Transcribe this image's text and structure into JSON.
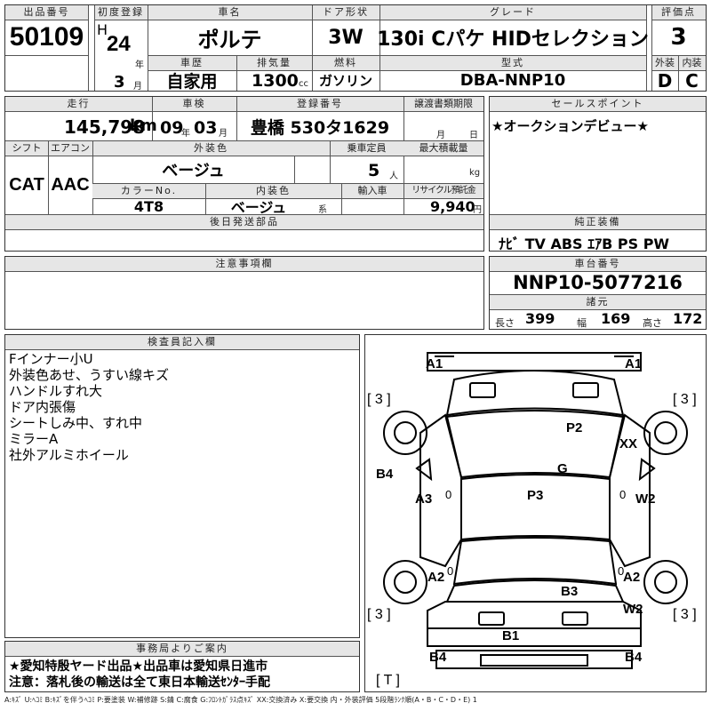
{
  "lot": {
    "label": "出品番号",
    "value": "50109"
  },
  "first_reg": {
    "label": "初度登録",
    "era": "H",
    "year": "24",
    "year_unit": "年",
    "month": "3",
    "month_unit": "月"
  },
  "car_name": {
    "label": "車名",
    "value": "ポルテ"
  },
  "door": {
    "label": "ドア形状",
    "value": "3W"
  },
  "grade": {
    "label": "グレード",
    "value": "130i Cパケ HIDセレクション"
  },
  "score": {
    "label": "評価点",
    "value": "3"
  },
  "history": {
    "label": "車歴",
    "value": "自家用"
  },
  "displacement": {
    "label": "排気量",
    "value": "1300",
    "unit": "cc"
  },
  "fuel": {
    "label": "燃料",
    "value": "ガソリン"
  },
  "model_code": {
    "label": "型式",
    "value": "DBA-NNP10"
  },
  "ext_grade": {
    "label": "外装",
    "value": "D"
  },
  "int_grade": {
    "label": "内装",
    "value": "C"
  },
  "mileage": {
    "label": "走行",
    "value": "145,798",
    "unit": "km"
  },
  "inspection": {
    "label": "車検",
    "year": "09",
    "year_unit": "年",
    "month": "03",
    "month_unit": "月"
  },
  "registration": {
    "label": "登録番号",
    "value": "豊橋 530タ1629"
  },
  "transfer": {
    "label": "譲渡書類期限",
    "month_unit": "月",
    "day_unit": "日"
  },
  "shift": {
    "label": "シフト",
    "value": "CAT"
  },
  "aircon": {
    "label": "エアコン",
    "value": "AAC"
  },
  "ext_color": {
    "label": "外装色",
    "value": "ベージュ"
  },
  "capacity": {
    "label": "乗車定員",
    "value": "5",
    "unit": "人"
  },
  "max_load": {
    "label": "最大積載量",
    "unit": "kg"
  },
  "color_no": {
    "label": "カラーNo.",
    "value": "4T8"
  },
  "int_color": {
    "label": "内装色",
    "value": "ベージュ",
    "unit": "系"
  },
  "import": {
    "label": "輸入車"
  },
  "recycle": {
    "label": "リサイクル預託金",
    "value": "9,940",
    "unit": "円"
  },
  "later_parts": {
    "label": "後日発送部品"
  },
  "sales_point": {
    "label": "セールスポイント",
    "value": "★オークションデビュー★"
  },
  "equipment": {
    "label": "純正装備",
    "value": "ﾅﾋﾞ TV ABS ｴｱB PS PW"
  },
  "notes": {
    "label": "注意事項欄"
  },
  "chassis": {
    "label": "車台番号",
    "value": "NNP10-5077216"
  },
  "specs": {
    "label": "諸元",
    "length_label": "長さ",
    "length": "399",
    "width_label": "幅",
    "width": "169",
    "height_label": "高さ",
    "height": "172"
  },
  "inspector": {
    "label": "検査員記入欄",
    "lines": [
      "Fインナー小U",
      "外装色あせ、うすい線キズ",
      "ハンドルすれ大",
      "ドア内張傷",
      "シートしみ中、すれ中",
      "ミラーA",
      "社外アルミホイール"
    ]
  },
  "office": {
    "label": "事務局よりご案内",
    "line1": "★愛知特殷ヤード出品★出品車は愛知県日進市",
    "line2": "注意：落札後の輸送は全て東日本輸送ｾﾝﾀｰ手配"
  },
  "damage": {
    "a1_left": "A1",
    "a1_right": "A1",
    "tire_fl": "[ 3 ]",
    "tire_fr": "[ 3 ]",
    "tire_rl": "[ 3 ]",
    "tire_rr": "[ 3 ]",
    "p2": "P2",
    "xx": "XX",
    "g": "G",
    "b4_left": "B4",
    "p3": "P3",
    "a3": "A3",
    "w2_right": "W2",
    "a2_left": "A2",
    "a2_right": "A2",
    "b3": "B3",
    "w2_rear": "W2",
    "b1": "B1",
    "b4_rl": "B4",
    "b4_rr": "B4",
    "zero1": "0",
    "zero2": "0",
    "zero3": "0",
    "zero4": "0",
    "t_mark": "[ T ]"
  },
  "legend": "A:ｷｽﾞ U:ﾍｺﾐ B:ｷｽﾞを伴うﾍｺﾐ P:要塗装 W:補修跡 S:錆 C:腐食 G:ﾌﾛﾝﾄｶﾞﾗｽ点ｷｽﾞ XX:交換済み X:要交換 内・外装評価 5段階ﾗﾝｸ順(A・B・C・D・E) 1"
}
